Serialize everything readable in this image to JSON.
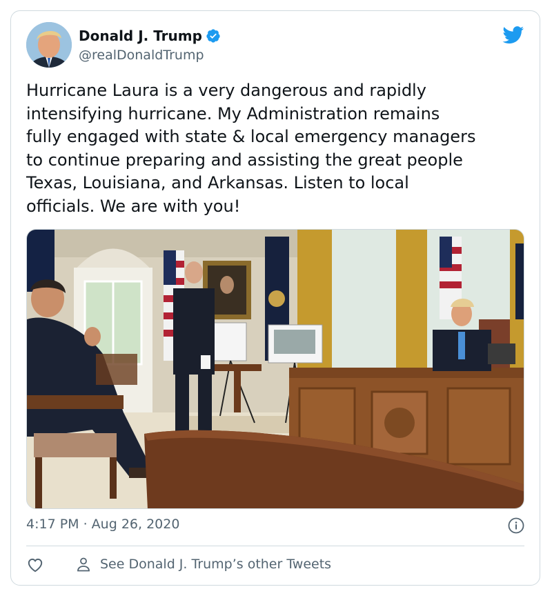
{
  "author": {
    "display_name": "Donald J. Trump",
    "handle": "@realDonaldTrump",
    "verified": true
  },
  "tweet": {
    "text": "Hurricane Laura is a very dangerous and rapidly\nintensifying hurricane. My Administration remains\nfully engaged with state & local emergency managers\nto continue preparing and assisting the great people\nTexas, Louisiana, and Arkansas. Listen to local\nofficials. We are with you!",
    "timestamp": "4:17 PM · Aug 26, 2020"
  },
  "actions": {
    "see_others_label": "See Donald J. Trump’s other Tweets"
  },
  "icons": {
    "brand": "twitter-bird-icon",
    "verified": "verified-badge-icon",
    "info": "info-icon",
    "like": "heart-icon",
    "profile": "person-icon"
  },
  "colors": {
    "brand_blue": "#1d9bf0",
    "text_primary": "#0f1419",
    "text_secondary": "#536471",
    "border": "#cfd9de"
  }
}
